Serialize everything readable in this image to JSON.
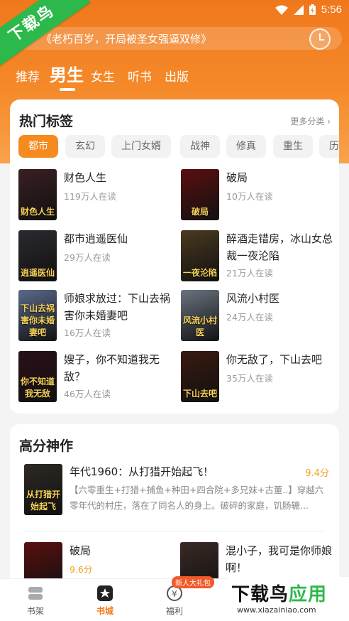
{
  "status": {
    "time": "5:56"
  },
  "corner_badge": "下载鸟",
  "search": {
    "text": "《老朽百岁，开局被圣女强逼双修》"
  },
  "tabs": [
    {
      "label": "推荐"
    },
    {
      "label": "男生"
    },
    {
      "label": "女生"
    },
    {
      "label": "听书"
    },
    {
      "label": "出版"
    }
  ],
  "hot": {
    "title": "热门标签",
    "more": "更多分类 ›",
    "tags": [
      "都市",
      "玄幻",
      "上门女婿",
      "战神",
      "修真",
      "重生",
      "历"
    ],
    "books": [
      {
        "title": "财色人生",
        "readers": "119万人在读",
        "cover_text": "财色人生",
        "color": "#3a1f22"
      },
      {
        "title": "破局",
        "readers": "10万人在读",
        "cover_text": "破局",
        "color": "#5a0f10"
      },
      {
        "title": "都市逍遥医仙",
        "readers": "29万人在读",
        "cover_text": "逍遥医仙",
        "color": "#2b2a30"
      },
      {
        "title": "醉酒走错房，冰山女总裁一夜沦陷",
        "readers": "21万人在读",
        "cover_text": "一夜沦陷",
        "color": "#4a3a20"
      },
      {
        "title": "师娘求放过：下山去祸害你未婚妻吧",
        "readers": "16万人在读",
        "cover_text": "下山去祸害你未婚妻吧",
        "color": "#5a6a8a"
      },
      {
        "title": "风流小村医",
        "readers": "24万人在读",
        "cover_text": "风流小村医",
        "color": "#6a7480"
      },
      {
        "title": "嫂子，你不知道我无敌？",
        "readers": "46万人在读",
        "cover_text": "你不知道我无敌",
        "color": "#2a1018"
      },
      {
        "title": "你无敌了，下山去吧",
        "readers": "35万人在读",
        "cover_text": "下山去吧",
        "color": "#3a1a10"
      }
    ]
  },
  "high": {
    "title": "高分神作",
    "featured": {
      "title": "年代1960：从打猎开始起飞！",
      "score": "9.4分",
      "desc": "【六零重生+打猎+捕鱼+种田+四合院+多兄妹+古董..】穿越六零年代的村庄，落在了同名人的身上。破碎的家庭，饥肠辘...",
      "cover_text": "从打猎开始起飞",
      "color": "#2e2a24"
    },
    "books": [
      {
        "title": "破局",
        "score": "9.6分",
        "color": "#5a0f10"
      },
      {
        "title": "混小子，我可是你师娘啊！",
        "score": "",
        "color": "#3a2a26"
      }
    ]
  },
  "nav": {
    "items": [
      {
        "label": "书架"
      },
      {
        "label": "书城"
      },
      {
        "label": "福利"
      }
    ],
    "badge": "新人大礼包"
  },
  "watermark": {
    "title_a": "下载鸟",
    "title_b": "应用",
    "url": "www.xiazainiao.com"
  },
  "colors": {
    "accent": "#f58a1f",
    "hero": "#f0781c",
    "badge_green": "#2db84b"
  }
}
